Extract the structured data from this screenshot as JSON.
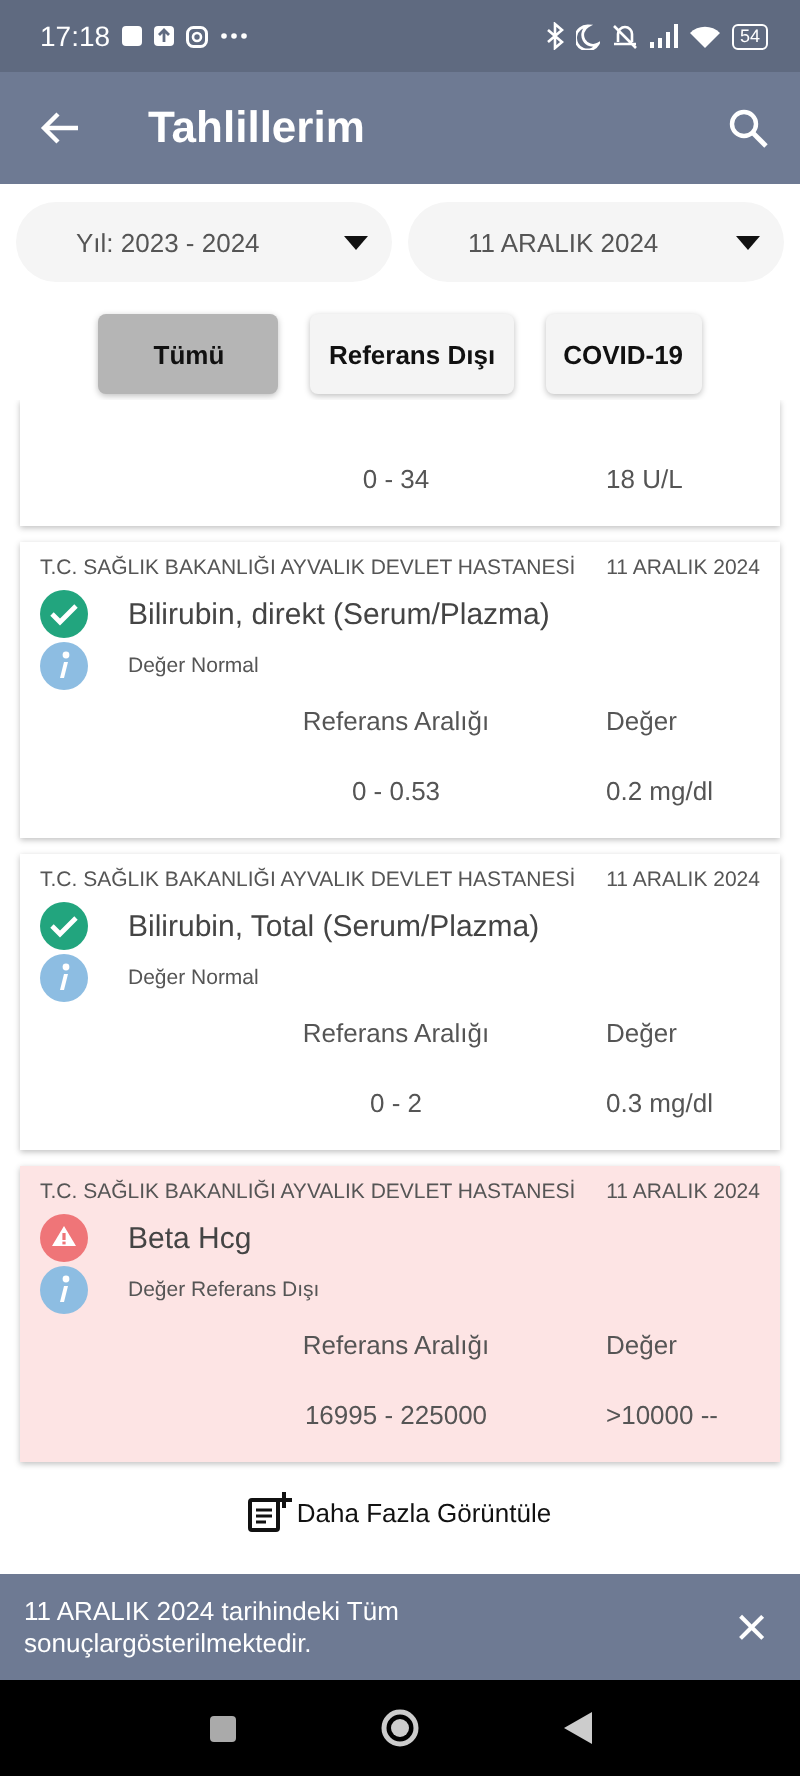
{
  "status_bar": {
    "time": "17:18",
    "battery": "54"
  },
  "app_bar": {
    "title": "Tahlillerim"
  },
  "filters": [
    {
      "label": "Yıl: 2023 - 2024"
    },
    {
      "label": "11 ARALIK 2024"
    }
  ],
  "chips": [
    {
      "label": "Tümü",
      "selected": true
    },
    {
      "label": "Referans Dışı",
      "selected": false
    },
    {
      "label": "COVID-19",
      "selected": false
    }
  ],
  "results": [
    {
      "kind": "partial",
      "range": "0 - 34",
      "value": "18 U/L"
    },
    {
      "kind": "full",
      "out_of_range": false,
      "hospital": "T.C. SAĞLIK BAKANLIĞI AYVALIK DEVLET HASTANESİ",
      "date": "11 ARALIK 2024",
      "test": "Bilirubin, direkt (Serum/Plazma)",
      "note": "Değer Normal",
      "range_label": "Referans Aralığı",
      "value_label": "Değer",
      "range": "0 - 0.53",
      "value": "0.2 mg/dl"
    },
    {
      "kind": "full",
      "out_of_range": false,
      "hospital": "T.C. SAĞLIK BAKANLIĞI AYVALIK DEVLET HASTANESİ",
      "date": "11 ARALIK 2024",
      "test": "Bilirubin, Total (Serum/Plazma)",
      "note": "Değer Normal",
      "range_label": "Referans Aralığı",
      "value_label": "Değer",
      "range": "0 - 2",
      "value": "0.3 mg/dl"
    },
    {
      "kind": "full",
      "out_of_range": true,
      "hospital": "T.C. SAĞLIK BAKANLIĞI AYVALIK DEVLET HASTANESİ",
      "date": "11 ARALIK 2024",
      "test": "Beta Hcg",
      "note": "Değer Referans Dışı",
      "range_label": "Referans Aralığı",
      "value_label": "Değer",
      "range": "16995 - 225000",
      "value": ">10000 --"
    }
  ],
  "more_button": "Daha Fazla Görüntüle",
  "snackbar": {
    "message": "11 ARALIK 2024 tarihindeki Tüm sonuçlargösterilmektedir.",
    "close": "×"
  }
}
